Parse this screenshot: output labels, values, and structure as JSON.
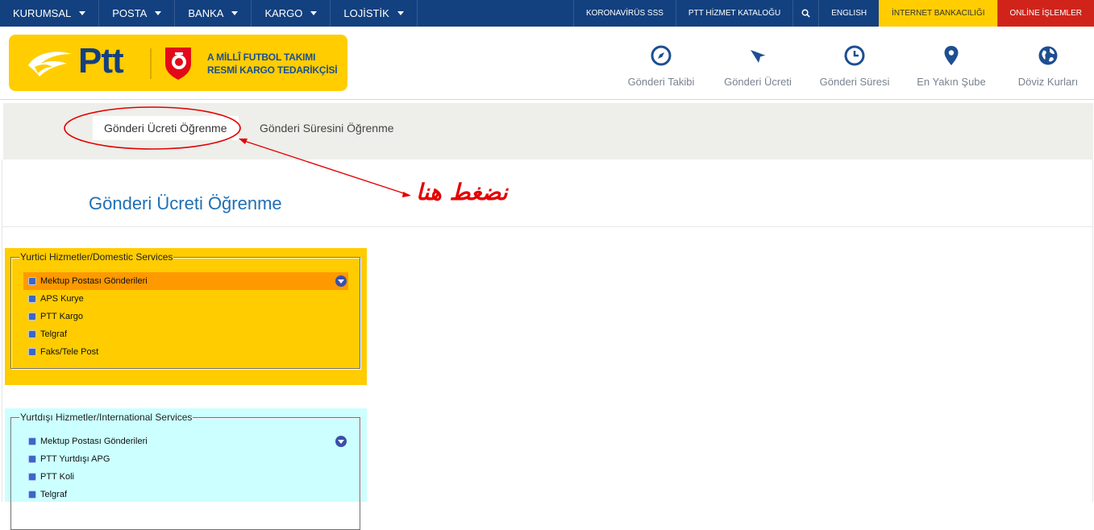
{
  "topnav": {
    "left": [
      "KURUMSAL",
      "POSTA",
      "BANKA",
      "KARGO",
      "LOJİSTİK"
    ],
    "right": {
      "corona": "KORONAVİRÜS SSS",
      "catalog": "PTT HİZMET KATALOĞU",
      "english": "ENGLISH",
      "banking": "İNTERNET BANKACILIĞI",
      "online": "ONLİNE İŞLEMLER"
    }
  },
  "header": {
    "logo_brand": "Ptt",
    "logo_sponsor_line1": "A MİLLÎ FUTBOL TAKIMI",
    "logo_sponsor_line2": "RESMİ KARGO TEDARİKÇİSİ",
    "quick_links": [
      {
        "label": "Gönderi Takibi",
        "icon": "compass-icon"
      },
      {
        "label": "Gönderi Ücreti",
        "icon": "paper-plane-icon"
      },
      {
        "label": "Gönderi Süresi",
        "icon": "clock-icon"
      },
      {
        "label": "En Yakın Şube",
        "icon": "map-pin-icon"
      },
      {
        "label": "Döviz Kurları",
        "icon": "globe-icon"
      }
    ]
  },
  "tabs": {
    "active": "Gönderi Ücreti Öğrenme",
    "inactive": "Gönderi Süresini Öğrenme"
  },
  "annotation": {
    "text": "نضغط هنا",
    "color": "#e40000"
  },
  "page_title": "Gönderi Ücreti Öğrenme",
  "domestic": {
    "legend": "Yurtici Hizmetler/Domestic Services",
    "items": [
      "Mektup Postası Gönderileri",
      "APS Kurye",
      "PTT Kargo",
      "Telgraf",
      "Faks/Tele Post"
    ]
  },
  "international": {
    "legend": "Yurtdışı Hizmetler/International Services",
    "items": [
      "Mektup Postası Gönderileri",
      "PTT Yurtdışı APG",
      "PTT Koli",
      "Telgraf"
    ]
  },
  "colors": {
    "navy": "#13407f",
    "ptt_yellow": "#ffcd00",
    "online_red": "#d0241b",
    "domestic_bg": "#ffcc00",
    "intl_bg": "#ccffff",
    "selected_row": "#ff9900",
    "title_blue": "#1f6fb4"
  }
}
